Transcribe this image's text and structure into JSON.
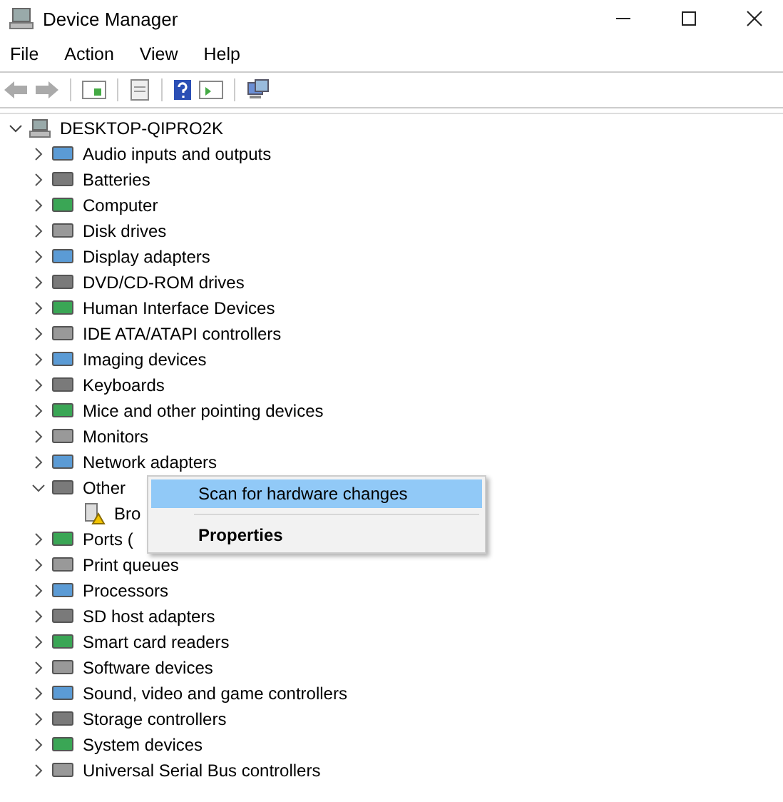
{
  "window": {
    "title": "Device Manager"
  },
  "menu_bar": [
    "File",
    "Action",
    "View",
    "Help"
  ],
  "tree": {
    "label": "DESKTOP-QIPRO2K",
    "expanded": true,
    "children": [
      {
        "label": "Audio inputs and outputs",
        "expanded": false
      },
      {
        "label": "Batteries",
        "expanded": false
      },
      {
        "label": "Computer",
        "expanded": false
      },
      {
        "label": "Disk drives",
        "expanded": false
      },
      {
        "label": "Display adapters",
        "expanded": false
      },
      {
        "label": "DVD/CD-ROM drives",
        "expanded": false
      },
      {
        "label": "Human Interface Devices",
        "expanded": false
      },
      {
        "label": "IDE ATA/ATAPI controllers",
        "expanded": false
      },
      {
        "label": "Imaging devices",
        "expanded": false
      },
      {
        "label": "Keyboards",
        "expanded": false
      },
      {
        "label": "Mice and other pointing devices",
        "expanded": false
      },
      {
        "label": "Monitors",
        "expanded": false
      },
      {
        "label": "Network adapters",
        "expanded": false
      },
      {
        "label": "Other",
        "expanded": true,
        "children": [
          {
            "label": "Bro"
          }
        ]
      },
      {
        "label": "Ports (",
        "expanded": false
      },
      {
        "label": "Print queues",
        "expanded": false
      },
      {
        "label": "Processors",
        "expanded": false
      },
      {
        "label": "SD host adapters",
        "expanded": false
      },
      {
        "label": "Smart card readers",
        "expanded": false
      },
      {
        "label": "Software devices",
        "expanded": false
      },
      {
        "label": "Sound, video and game controllers",
        "expanded": false
      },
      {
        "label": "Storage controllers",
        "expanded": false
      },
      {
        "label": "System devices",
        "expanded": false
      },
      {
        "label": "Universal Serial Bus controllers",
        "expanded": false
      }
    ]
  },
  "context_menu": [
    {
      "label": "Scan for hardware changes",
      "selected": true,
      "default": false
    },
    {
      "label": "Properties",
      "selected": false,
      "default": true
    }
  ]
}
